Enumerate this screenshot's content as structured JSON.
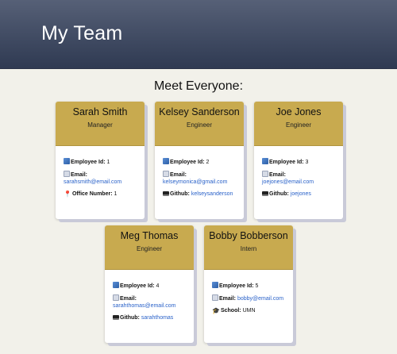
{
  "header": {
    "title": "My Team"
  },
  "subtitle": "Meet Everyone:",
  "labels": {
    "id": "Employee Id:",
    "email": "Email:",
    "office": "Office Number:",
    "github": "Github:",
    "school": "School:"
  },
  "cards": [
    {
      "name": "Sarah Smith",
      "role": "Manager",
      "id": "1",
      "email": "sarahsmith@email.com",
      "office": "1"
    },
    {
      "name": "Kelsey Sanderson",
      "role": "Engineer",
      "id": "2",
      "email": "kelseymonica@gmail.com",
      "github": "kelseysanderson"
    },
    {
      "name": "Joe Jones",
      "role": "Engineer",
      "id": "3",
      "email": "joejones@email.com",
      "github": "joejones"
    },
    {
      "name": "Meg Thomas",
      "role": "Engineer",
      "id": "4",
      "email": "sarahthomas@email.com",
      "github": "sarahthomas"
    },
    {
      "name": "Bobby Bobberson",
      "role": "Intern",
      "id": "5",
      "email": "bobby@email.com",
      "school": "UMN"
    }
  ],
  "colors": {
    "header_top": "#566077",
    "header_bottom": "#2f3a52",
    "card_head": "#c8aa4f",
    "link": "#2a62c9",
    "background": "#f2f1ea"
  },
  "icons": {
    "id": "id-emoji-icon",
    "email": "envelope-icon",
    "office": "pin-icon",
    "github": "laptop-icon",
    "school": "grad-cap-icon"
  }
}
